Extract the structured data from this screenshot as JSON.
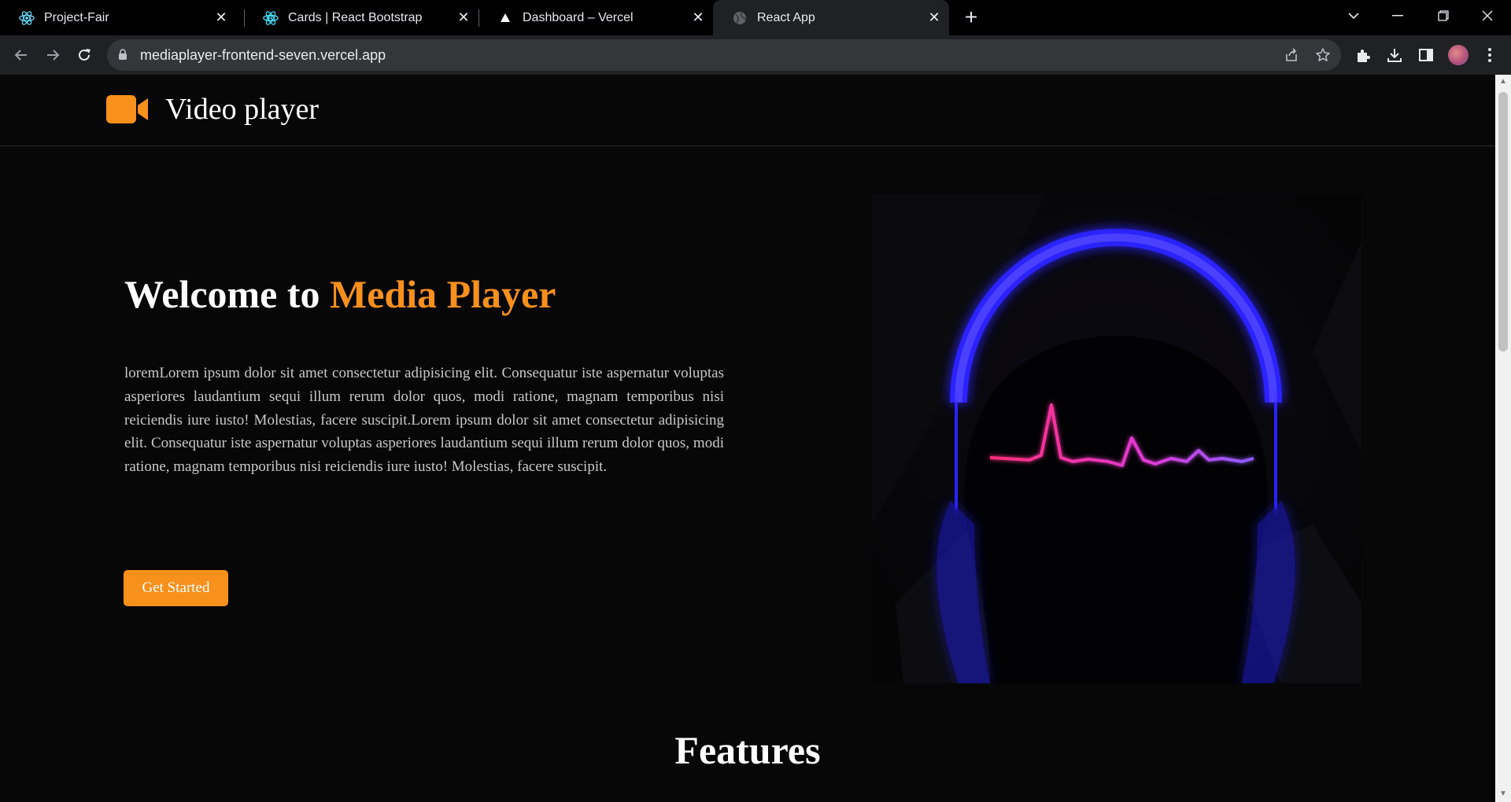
{
  "browser": {
    "tabs": [
      {
        "title": "Project-Fair",
        "favicon": "react-icon",
        "active": false
      },
      {
        "title": "Cards | React Bootstrap",
        "favicon": "react-bootstrap-icon",
        "active": false
      },
      {
        "title": "Dashboard – Vercel",
        "favicon": "vercel-triangle-icon",
        "active": false
      },
      {
        "title": "React App",
        "favicon": "globe-icon",
        "active": true
      }
    ],
    "url": "mediaplayer-frontend-seven.vercel.app"
  },
  "site": {
    "brand": "Video player",
    "accent_color": "#f8901c",
    "hero": {
      "title_prefix": "Welcome to",
      "title_accent": "Media Player",
      "body": "loremLorem ipsum dolor sit amet consectetur adipisicing elit. Consequatur iste aspernatur voluptas asperiores laudantium sequi illum rerum dolor quos, modi ratione, magnam temporibus nisi reiciendis iure iusto! Molestias, facere suscipit.Lorem ipsum dolor sit amet consectetur adipisicing elit. Consequatur iste aspernatur voluptas asperiores laudantium sequi illum rerum dolor quos, modi ratione, magnam temporibus nisi reiciendis iure iusto! Molestias, facere suscipit.",
      "cta_label": "Get Started"
    },
    "features_title": "Features"
  }
}
